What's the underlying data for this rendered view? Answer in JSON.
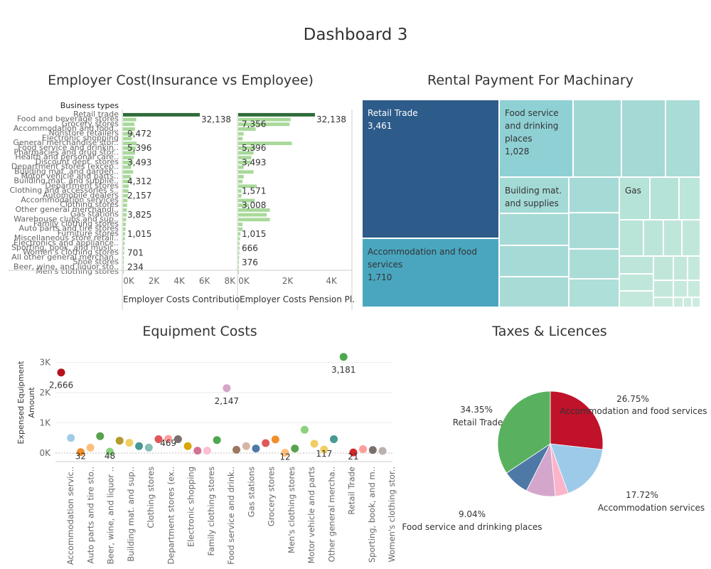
{
  "dashboard": {
    "title": "Dashboard 3"
  },
  "employer": {
    "title": "Employer Cost(Insurance vs Employee)",
    "row_header": "Business types",
    "col1_title": "Employer Costs Contributio..",
    "col2_title": "Employer Costs Pension Pl..",
    "col1_ticks": [
      "0K",
      "2K",
      "4K",
      "6K",
      "8K"
    ],
    "col2_ticks": [
      "0K",
      "2K",
      "4K"
    ]
  },
  "rental": {
    "title": "Rental Payment  For Machinary"
  },
  "equipment": {
    "title": "Equipment Costs",
    "ylabel_line1": "Expensed Equipment",
    "ylabel_line2": "Amount"
  },
  "taxes": {
    "title": "Taxes & Licences"
  },
  "chart_data": [
    {
      "type": "bar",
      "title": "Employer Cost(Insurance vs Employee)",
      "row_header": "Business types",
      "categories": [
        "Retail trade",
        "Food and beverage stores",
        "Grocery stores",
        "Accommodation and food..",
        "Nonstore retailers",
        "Electronic shopping",
        "General merchandise stor..",
        "Food service and drinkin..",
        "Pharmacies and drug stor..",
        "Health and personal care..",
        "Discount dept. stores",
        "Department stores (excep..",
        "Building mat. and garden..",
        "Motor vehicle and parts..",
        "Building mat. and supplie..",
        "Department stores",
        "Clothing and accessories s..",
        "Automobile dealers",
        "Accommodation services",
        "Clothing stores",
        "Other general merchandi..",
        "Gas stations",
        "Warehouse clubs and sup..",
        "Family clothing stores",
        "Auto parts and tire stores",
        "Furniture stores",
        "Miscellaneous store retail..",
        "Electronics and appliance..",
        "Sporting, book, and music..",
        "Women's clothing stores",
        "All other general merchan..",
        "Shoe stores",
        "Beer, wine, and liquor sto..",
        "Men's clothing stores"
      ],
      "series": [
        {
          "name": "Employer Costs Contributio..",
          "values": [
            32138,
            1050,
            900,
            950,
            850,
            700,
            1080,
            1000,
            950,
            850,
            800,
            650,
            800,
            600,
            550,
            450,
            430,
            400,
            350,
            320,
            300,
            280,
            250,
            220,
            200,
            170,
            150,
            130,
            100,
            90,
            70,
            60,
            50,
            40
          ]
        },
        {
          "name": "Employer Costs Pension Pl..",
          "values": [
            32138,
            2400,
            2350,
            800,
            250,
            200,
            2450,
            800,
            700,
            600,
            600,
            250,
            700,
            250,
            200,
            850,
            150,
            150,
            750,
            500,
            1450,
            1300,
            1450,
            200,
            200,
            100,
            80,
            60,
            60,
            50,
            40,
            30,
            20,
            10
          ]
        }
      ],
      "data_labels": [
        {
          "col": 1,
          "row": 1,
          "text": "32,138"
        },
        {
          "col": 1,
          "row": 4,
          "text": "9,472"
        },
        {
          "col": 1,
          "row": 7,
          "text": "5,396"
        },
        {
          "col": 1,
          "row": 10,
          "text": "3,493"
        },
        {
          "col": 1,
          "row": 14,
          "text": "4,312"
        },
        {
          "col": 1,
          "row": 17,
          "text": "2,157"
        },
        {
          "col": 1,
          "row": 21,
          "text": "3,825"
        },
        {
          "col": 1,
          "row": 25,
          "text": "1,015"
        },
        {
          "col": 1,
          "row": 29,
          "text": "701"
        },
        {
          "col": 1,
          "row": 32,
          "text": "234"
        },
        {
          "col": 2,
          "row": 1,
          "text": "32,138"
        },
        {
          "col": 2,
          "row": 2,
          "text": "7,356"
        },
        {
          "col": 2,
          "row": 7,
          "text": "5,396"
        },
        {
          "col": 2,
          "row": 10,
          "text": "3,493"
        },
        {
          "col": 2,
          "row": 16,
          "text": "1,571"
        },
        {
          "col": 2,
          "row": 19,
          "text": "3,008"
        },
        {
          "col": 2,
          "row": 25,
          "text": "1,015"
        },
        {
          "col": 2,
          "row": 28,
          "text": "666"
        },
        {
          "col": 2,
          "row": 31,
          "text": "376"
        }
      ],
      "xlim_col1": [
        0,
        9000
      ],
      "xlim_col2": [
        0,
        5200
      ],
      "colors": {
        "highlight": "#2e6b3a",
        "bar": "#a8d99a"
      }
    },
    {
      "type": "treemap",
      "title": "Rental Payment  For Machinary",
      "items": [
        {
          "name": "Retail Trade",
          "value": 3461,
          "label": "3,461",
          "color": "#2d5b8a"
        },
        {
          "name": "Accommodation and food services",
          "value": 1710,
          "label": "1,710",
          "color": "#4aa6bf"
        },
        {
          "name": "Food service and drinking places",
          "value": 1028,
          "label": "1,028",
          "color": "#8fd0d4"
        },
        {
          "name": "Building mat. and supplies",
          "value": 700,
          "color": "#a4dad6"
        },
        {
          "name": "Gas",
          "value": 450,
          "color": "#b6e3d7"
        }
      ]
    },
    {
      "type": "scatter",
      "title": "Equipment Costs",
      "ylabel": "Expensed Equipment Amount",
      "yticks": [
        "0K",
        "1K",
        "2K",
        "3K"
      ],
      "ylim": [
        0,
        3500
      ],
      "x_tick_labels": [
        "Accommodation servic..",
        "Auto parts and tire sto..",
        "Beer, wine, and liquor ..",
        "Building mat. and sup..",
        "Clothing stores",
        "Department stores (ex..",
        "Electronic shopping",
        "Family clothing stores",
        "Food service and drink..",
        "Gas stations",
        "Grocery stores",
        "Men's clothing stores",
        "Motor vehicle and parts",
        "Other general mercha..",
        "Retail Trade",
        "Sporting, book, and m..",
        "Women's clothing stor.."
      ],
      "points": [
        {
          "value": 2666,
          "label": "2,666",
          "color": "#b5121b"
        },
        {
          "value": 500,
          "color": "#a0cbe8"
        },
        {
          "value": 32,
          "label": "32",
          "color": "#f28e2b"
        },
        {
          "value": 180,
          "color": "#ffbe7d"
        },
        {
          "value": 560,
          "color": "#59a14f"
        },
        {
          "value": 48,
          "label": "48",
          "color": "#8cd17d"
        },
        {
          "value": 410,
          "color": "#b6992d"
        },
        {
          "value": 340,
          "color": "#f1ce63"
        },
        {
          "value": 230,
          "color": "#499894"
        },
        {
          "value": 180,
          "color": "#86bcb6"
        },
        {
          "value": 460,
          "color": "#e15759"
        },
        {
          "value": 469,
          "label": "469",
          "color": "#ff9d9a"
        },
        {
          "value": 460,
          "color": "#79706e"
        },
        {
          "value": 230,
          "color": "#d7a70b"
        },
        {
          "value": 80,
          "color": "#d37295"
        },
        {
          "value": 80,
          "color": "#fabfd2"
        },
        {
          "value": 430,
          "color": "#4ea84f"
        },
        {
          "value": 2147,
          "label": "2,147",
          "color": "#d4a6c8"
        },
        {
          "value": 110,
          "color": "#9d7660"
        },
        {
          "value": 230,
          "color": "#d7b5a6"
        },
        {
          "value": 150,
          "color": "#4e79a7"
        },
        {
          "value": 330,
          "color": "#e15759"
        },
        {
          "value": 450,
          "color": "#f28e2b"
        },
        {
          "value": 12,
          "label": "12",
          "color": "#ffbe7d"
        },
        {
          "value": 150,
          "color": "#59a14f"
        },
        {
          "value": 770,
          "color": "#8cd17d"
        },
        {
          "value": 310,
          "color": "#f1ce63"
        },
        {
          "value": 117,
          "label": "117",
          "color": "#f1ce63"
        },
        {
          "value": 460,
          "color": "#499894"
        },
        {
          "value": 3181,
          "label": "3,181",
          "color": "#4ea84f"
        },
        {
          "value": 21,
          "label": "21",
          "color": "#d62728"
        },
        {
          "value": 130,
          "color": "#ff9d9a"
        },
        {
          "value": 100,
          "color": "#79706e"
        },
        {
          "value": 70,
          "color": "#bab0ac"
        }
      ]
    },
    {
      "type": "pie",
      "title": "Taxes & Licences",
      "slices": [
        {
          "name": "Accommodation and food services",
          "percent": 26.75,
          "label": "26.75%",
          "color": "#c0122a"
        },
        {
          "name": "Accommodation services",
          "percent": 17.72,
          "label": "17.72%",
          "color": "#9ecae9"
        },
        {
          "name": "",
          "percent": 4.0,
          "color": "#fbb4c9"
        },
        {
          "name": "Food service and drinking places",
          "percent": 9.04,
          "label": "9.04%",
          "color": "#d5a6cc"
        },
        {
          "name": "",
          "percent": 8.14,
          "color": "#4e79a7"
        },
        {
          "name": "Retail Trade",
          "percent": 34.35,
          "label": "34.35%",
          "color": "#59b15f"
        }
      ]
    }
  ]
}
